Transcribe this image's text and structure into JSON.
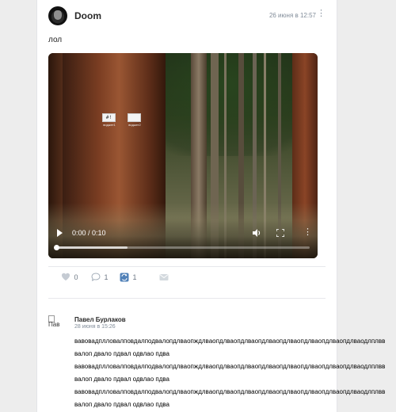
{
  "post": {
    "author": "Doom",
    "date": "26 июня в 12:57",
    "text": "лол",
    "video": {
      "time": "0:00 / 0:10",
      "progress": 0.28,
      "overlay_icons": [
        {
          "symbol": "#!",
          "caption": "виджет1"
        },
        {
          "symbol": "",
          "caption": "виджет2"
        }
      ]
    },
    "actions": {
      "likes": "0",
      "comments": "1",
      "reposts": "1"
    }
  },
  "comment": {
    "avatar_alt": "Пав",
    "author": "Павел Бурлаков",
    "date": "28 июня в 15:26",
    "lines": [
      "вавовадплловалповдалподвалопдлваопждлваопдлваопдлваопдлваопдлваопдлваопдлваопдлваодлплвв",
      "валоп двало пдвал одвлао пдва",
      "вавовадплловалповдалподвалопдлваопждлваопдлваопдлваопдлваопдлваопдлваопдлваопдлваодлплвв",
      "валоп двало пдвал одвлао пдва",
      "вавовадплловалповдалподвалопдлваопждлваопдлваопдлваопдлваопдлваопдлваопдлваопдлваодлплвв",
      "валоп двало пдвал одвлао пдва"
    ]
  },
  "colors": {
    "accent": "#5181b8",
    "secondary_text": "#818c99",
    "background": "#ededed"
  },
  "icons": [
    "heart-icon",
    "comment-icon",
    "repost-icon",
    "share-icon",
    "play-icon",
    "volume-icon",
    "fullscreen-icon",
    "more-icon"
  ]
}
